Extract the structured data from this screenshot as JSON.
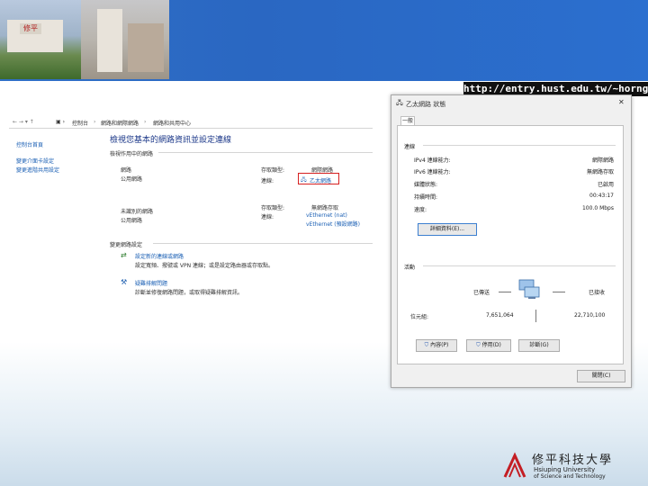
{
  "banner": {
    "url": "http://entry.hust.edu.tw/~horng",
    "photo_sign": "修平"
  },
  "breadcrumb": [
    "控制台",
    "網路和網際網路",
    "網路和共用中心"
  ],
  "left_nav": [
    "控制台首頁",
    "變更介面卡設定",
    "變更進階共用設定"
  ],
  "main": {
    "heading": "檢視您基本的網路資訊並設定連線",
    "active_label": "檢視作用中的網路",
    "network_name": "網路",
    "network_type": "公用網路",
    "access_type_label": "存取類型:",
    "access_type_value": "網際網路",
    "connections_label": "連線:",
    "connection_value": "乙太網路",
    "unknown_label": "未識別的網路",
    "unknown_type": "公用網路",
    "access_type_label2": "存取類型:",
    "access_type_value2": "無網路存取",
    "connections_label2": "連線:",
    "conn2a": "vEthernet (nat)",
    "conn2b": "vEthernet (預設網路)",
    "change_label": "變更網路設定",
    "setup_title": "設定新的連線或網路",
    "setup_desc": "設定寬頻、撥號或 VPN 連線；或是設定路由器或存取點。",
    "trouble_title": "疑難排解問題",
    "trouble_desc": "診斷並修復網路問題，或取得疑難排解資訊。"
  },
  "dialog": {
    "title": "乙太網路 狀態",
    "close": "✕",
    "tab": "一般",
    "section_conn": "連線",
    "rows": [
      {
        "label": "IPv4 連線能力:",
        "value": "網際網路"
      },
      {
        "label": "IPv6 連線能力:",
        "value": "無網路存取"
      },
      {
        "label": "媒體狀態:",
        "value": "已啟用"
      },
      {
        "label": "持續時間:",
        "value": "00:43:17"
      },
      {
        "label": "速度:",
        "value": "100.0 Mbps"
      }
    ],
    "details_btn": "詳細資料(E)...",
    "section_activity": "活動",
    "sent_label": "已傳送",
    "recv_label": "已接收",
    "bytes_label": "位元組:",
    "bytes_sent": "7,651,064",
    "bytes_recv": "22,710,100",
    "props_btn": "內容(P)",
    "disable_btn": "停用(D)",
    "diagnose_btn": "診斷(G)",
    "close_btn": "關閉(C)"
  },
  "logo": {
    "name": "修平科技大學",
    "en1": "Hsiuping University",
    "en2": "of Science and Technology"
  },
  "colors": {
    "banner": "#2b6bc6",
    "link": "#1a5fb4",
    "highlight": "#d62020"
  }
}
